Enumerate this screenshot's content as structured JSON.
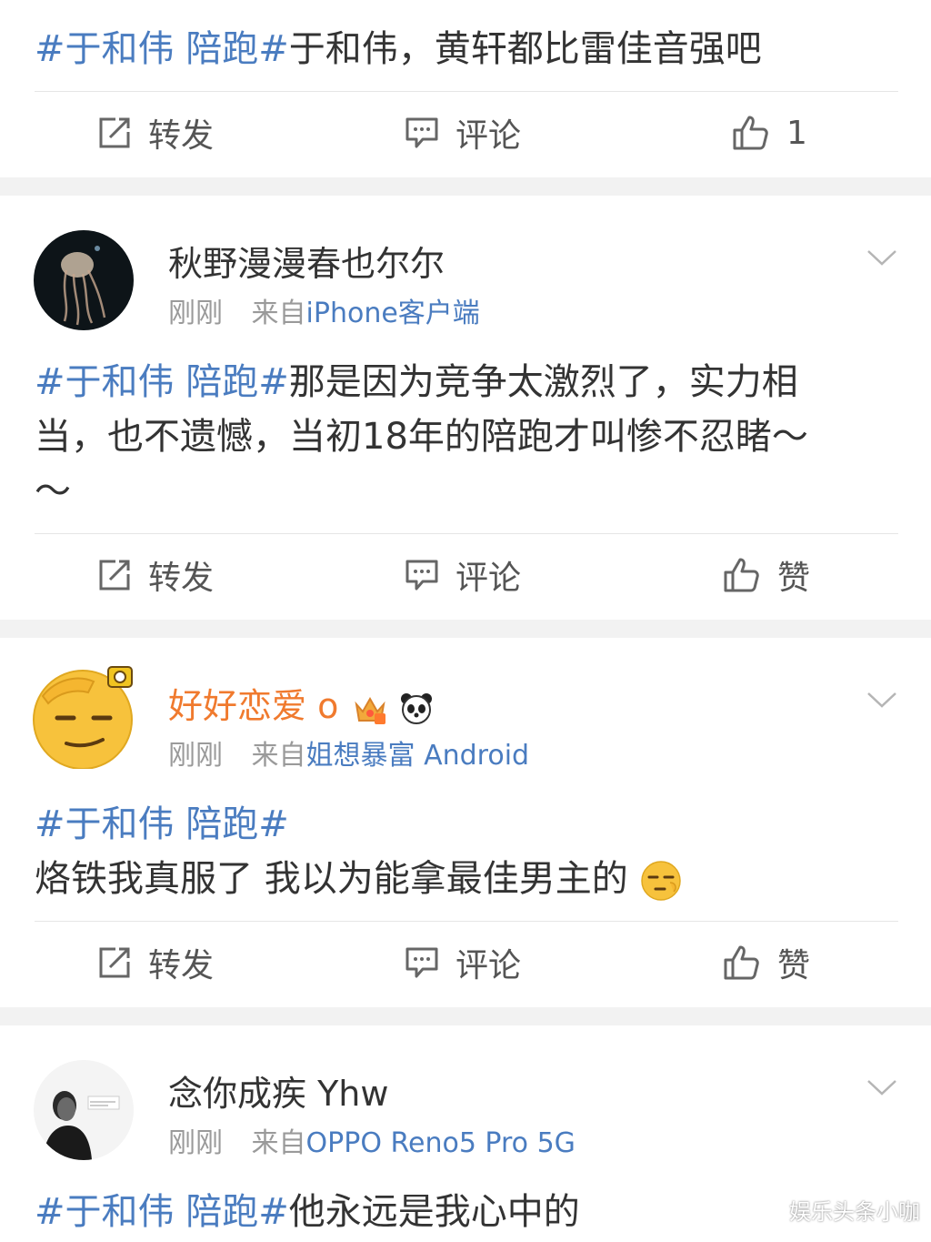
{
  "top_post": {
    "hashtag": "#于和伟 陪跑#",
    "text": "于和伟，黄轩都比雷佳音强吧",
    "actions": {
      "repost": "转发",
      "comment": "评论",
      "like": "1"
    }
  },
  "posts": [
    {
      "username": "秋野漫漫春也尔尔",
      "time": "刚刚",
      "from_label": "来自",
      "source": "iPhone客户端",
      "hashtag": "#于和伟 陪跑#",
      "line1": "那是因为竞争太激烈了，实力相",
      "line2": "当，也不遗憾，当初18年的陪跑才叫惨不忍睹～",
      "line3": "～",
      "actions": {
        "repost": "转发",
        "comment": "评论",
        "like": "赞"
      }
    },
    {
      "username": "好好恋爱 o",
      "time": "刚刚",
      "from_label": "来自",
      "source": "姐想暴富 Android",
      "hashtag": "#于和伟 陪跑#",
      "line2": "烙铁我真服了 我以为能拿最佳男主的",
      "actions": {
        "repost": "转发",
        "comment": "评论",
        "like": "赞"
      }
    },
    {
      "username": "念你成疾 Yhw",
      "time": "刚刚",
      "from_label": "来自",
      "source": "OPPO Reno5 Pro 5G",
      "hashtag": "#于和伟 陪跑#",
      "text": "他永远是我心中的"
    }
  ],
  "watermark": "娱乐头条小咖",
  "colors": {
    "link": "#4a7cc0",
    "orange_name": "#f07a2e",
    "separator": "#f2f2f2"
  }
}
